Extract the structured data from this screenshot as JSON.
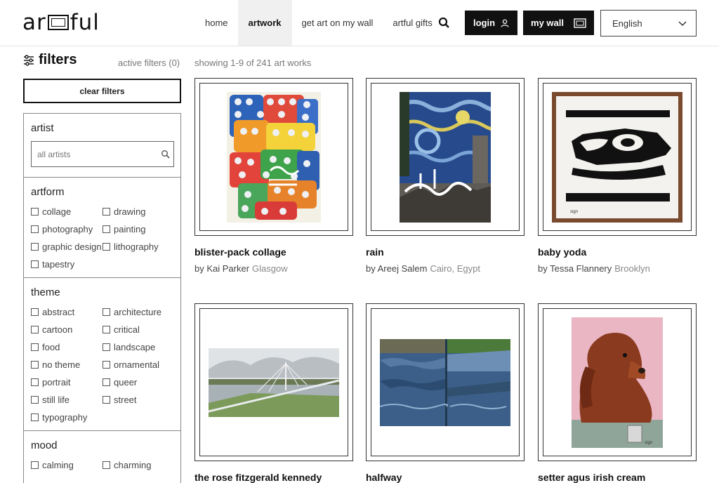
{
  "header": {
    "logo_left": "ar",
    "logo_right": "ful",
    "nav": [
      "home",
      "artwork",
      "get art on my wall",
      "artful gifts"
    ],
    "active_nav": "artwork",
    "login_label": "login",
    "wall_label": "my wall",
    "language": "English"
  },
  "filters": {
    "title": "filters",
    "active_label": "active filters (0)",
    "clear_label": "clear filters",
    "artist": {
      "title": "artist",
      "placeholder": "all artists"
    },
    "artform": {
      "title": "artform",
      "options": [
        "collage",
        "drawing",
        "photography",
        "painting",
        "graphic design",
        "lithography",
        "tapestry"
      ]
    },
    "theme": {
      "title": "theme",
      "options": [
        "abstract",
        "architecture",
        "cartoon",
        "critical",
        "food",
        "landscape",
        "no theme",
        "ornamental",
        "portrait",
        "queer",
        "still life",
        "street",
        "typography"
      ]
    },
    "mood": {
      "title": "mood",
      "options": [
        "calming",
        "charming"
      ]
    }
  },
  "results": {
    "showing": "showing 1-9 of 241 art works"
  },
  "artworks": [
    {
      "title": "blister-pack collage",
      "by": "by Kai Parker",
      "city": "Glasgow"
    },
    {
      "title": "rain",
      "by": "by Areej Salem",
      "city": "Cairo, Egypt"
    },
    {
      "title": "baby yoda",
      "by": "by Tessa Flannery",
      "city": "Brooklyn"
    },
    {
      "title": "the rose fitzgerald kennedy",
      "by": "",
      "city": ""
    },
    {
      "title": "halfway",
      "by": "",
      "city": ""
    },
    {
      "title": "setter agus irish cream",
      "by": "",
      "city": ""
    }
  ],
  "colors": {
    "dark": "#111111",
    "border": "#333333",
    "muted": "#888888"
  }
}
